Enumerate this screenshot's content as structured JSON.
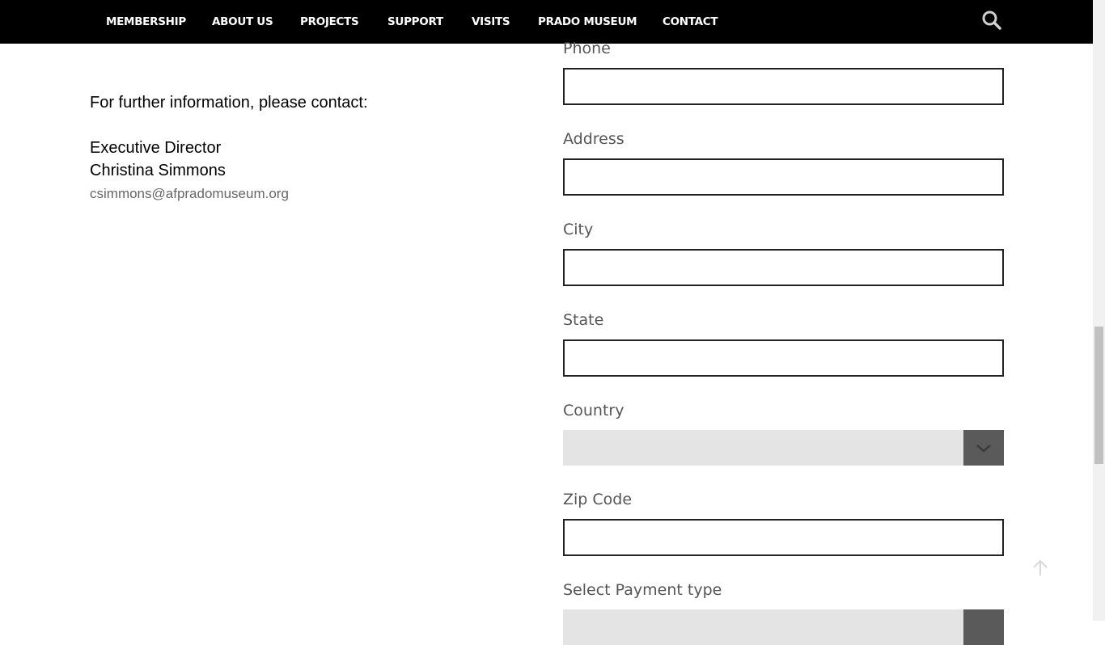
{
  "nav": {
    "items": [
      {
        "label": "MEMBERSHIP"
      },
      {
        "label": "ABOUT US"
      },
      {
        "label": "PROJECTS"
      },
      {
        "label": "SUPPORT"
      },
      {
        "label": "VISITS"
      },
      {
        "label": "PRADO MUSEUM"
      },
      {
        "label": "CONTACT"
      }
    ],
    "search_icon": "search-icon"
  },
  "contact": {
    "intro": "For further information, please contact:",
    "role": "Executive Director",
    "name": "Christina Simmons",
    "email": "csimmons@afpradomuseum.org"
  },
  "form": {
    "phone_label": "Phone",
    "phone_value": "",
    "address_label": "Address",
    "address_value": "",
    "city_label": "City",
    "city_value": "",
    "state_label": "State",
    "state_value": "",
    "country_label": "Country",
    "country_value": "",
    "zip_label": "Zip Code",
    "zip_value": "",
    "payment_label": "Select Payment type",
    "payment_value": ""
  },
  "icons": {
    "dropdown": "chevron-down-icon",
    "scroll_top": "arrow-up-icon"
  },
  "colors": {
    "nav_bg": "#000000",
    "nav_text": "#ffffff",
    "select_bg": "#e4e4e4",
    "select_arrow_bg": "#5a5a5a"
  }
}
